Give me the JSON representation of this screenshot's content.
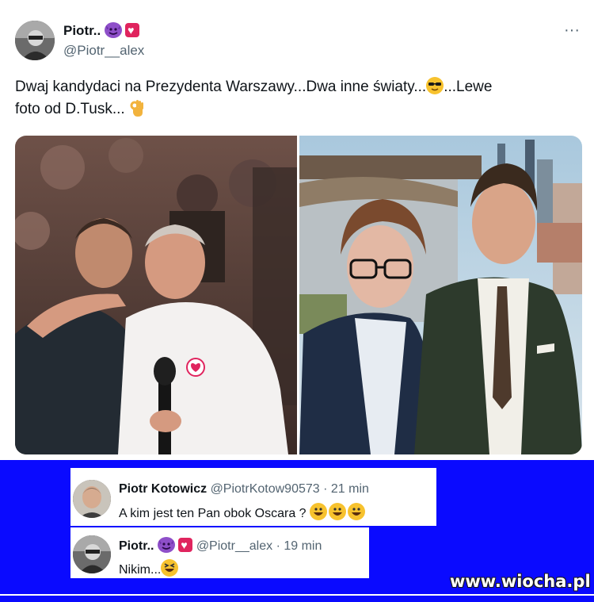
{
  "post": {
    "author_name": "Piotr..",
    "author_handle": "@Piotr__alex",
    "more_label": "···",
    "text_line1": "Dwaj kandydaci na Prezydenta Warszawy...Dwa inne światy...",
    "text_line1_tail": "...Lewe",
    "text_line2": "foto od D.Tusk...",
    "emoji_names": [
      "smiling-devil-icon",
      "heart-icon",
      "sunglasses-face-icon",
      "ok-hand-icon"
    ]
  },
  "replies": [
    {
      "name": "Piotr Kotowicz",
      "handle": "@PiotrKotow90573",
      "time": "· 21 min",
      "text": "A kim jest ten Pan obok Oscara ?"
    },
    {
      "name": "Piotr..",
      "handle": "@Piotr__alex",
      "time": "· 19 min",
      "text": "Nikim..."
    }
  ],
  "watermark": "www.wiocha.pl",
  "colors": {
    "banner_blue": "#0a0aff",
    "handle_gray": "#536471",
    "text_dark": "#0f1419"
  }
}
